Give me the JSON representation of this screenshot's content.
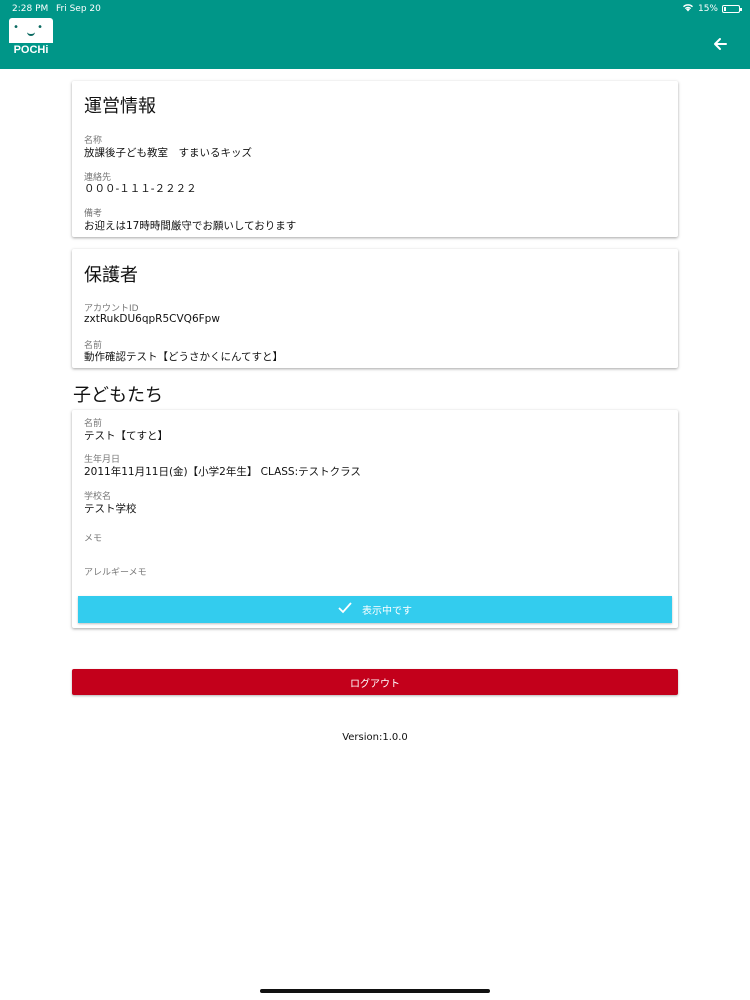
{
  "status_bar": {
    "time": "2:28 PM",
    "date": "Fri Sep 20",
    "battery": "15%",
    "battery_level": 0.15,
    "wifi_icon": "wifi-icon",
    "battery_icon": "battery-icon"
  },
  "app_bar": {
    "logo_text": "POCHi",
    "back_icon": "arrow-left-icon",
    "color": "#009688"
  },
  "operation_info": {
    "title": "運営情報",
    "name_label": "名称",
    "name_value": "放課後子ども教室　すまいるキッズ",
    "contact_label": "連絡先",
    "contact_value": "０００-１１１-２２２２",
    "notes_label": "備考",
    "notes_value": "お迎えは17時時間厳守でお願いしております"
  },
  "guardian": {
    "title": "保護者",
    "account_label": "アカウントID",
    "account_value": "zxtRukDU6qpR5CVQ6Fpw",
    "name_label": "名前",
    "name_value": "動作確認テスト【どうさかくにんてすと】"
  },
  "children": {
    "title": "子どもたち",
    "items": [
      {
        "name_label": "名前",
        "name_value": "テスト【てすと】",
        "birthday_label": "生年月日",
        "birthday_value": "2011年11月11日(金)【小学2年生】 CLASS:テストクラス",
        "school_label": "学校名",
        "school_value": "テスト学校",
        "memo_label": "メモ",
        "memo_value": "",
        "allergy_label": "アレルギーメモ",
        "allergy_value": "",
        "shown_button": "表示中です",
        "check_icon": "check-icon"
      }
    ]
  },
  "logout_button": "ログアウト",
  "version": "Version:1.0.0",
  "colors": {
    "primary": "#009688",
    "shown_button": "#33ccee",
    "logout": "#c3001b"
  }
}
